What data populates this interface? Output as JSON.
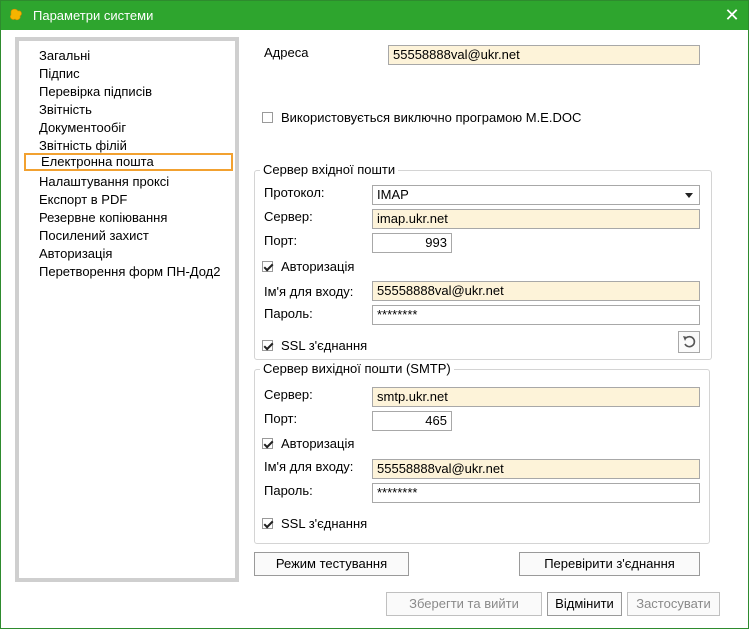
{
  "window": {
    "title": "Параметри системи"
  },
  "sidebar": {
    "items": [
      "Загальні",
      "Підпис",
      "Перевірка підписів",
      "Звітність",
      "Документообіг",
      "Звітність філій",
      "Електронна пошта",
      "Налаштування проксі",
      "Експорт в PDF",
      "Резервне копіювання",
      "Посилений захист",
      "Авторизація",
      "Перетворення форм ПН-Дод2"
    ],
    "active_index": 6
  },
  "main": {
    "address_label": "Адреса",
    "address_value": "55558888val@ukr.net",
    "exclusive_label": "Використовується виключно програмою M.E.DOC",
    "exclusive_checked": false,
    "incoming": {
      "title": "Сервер вхідної пошти",
      "protocol_label": "Протокол:",
      "protocol_value": "IMAP",
      "server_label": "Сервер:",
      "server_value": "imap.ukr.net",
      "port_label": "Порт:",
      "port_value": "993",
      "auth_label": "Авторизація",
      "auth_checked": true,
      "login_label": "Ім'я для входу:",
      "login_value": "55558888val@ukr.net",
      "password_label": "Пароль:",
      "password_value": "********",
      "ssl_label": "SSL з'єднання",
      "ssl_checked": true
    },
    "outgoing": {
      "title": "Сервер вихідної пошти (SMTP)",
      "server_label": "Сервер:",
      "server_value": "smtp.ukr.net",
      "port_label": "Порт:",
      "port_value": "465",
      "auth_label": "Авторизація",
      "auth_checked": true,
      "login_label": "Ім'я для входу:",
      "login_value": "55558888val@ukr.net",
      "password_label": "Пароль:",
      "password_value": "********",
      "ssl_label": "SSL з'єднання",
      "ssl_checked": true
    },
    "test_mode_label": "Режим тестування",
    "check_connection_label": "Перевірити з'єднання"
  },
  "footer": {
    "save_exit_label": "Зберегти та вийти",
    "cancel_label": "Відмінити",
    "apply_label": "Застосувати"
  },
  "colors": {
    "titlebar": "#2ea52e",
    "active_outline": "#f2a130",
    "required_field": "#fdf3d9"
  }
}
